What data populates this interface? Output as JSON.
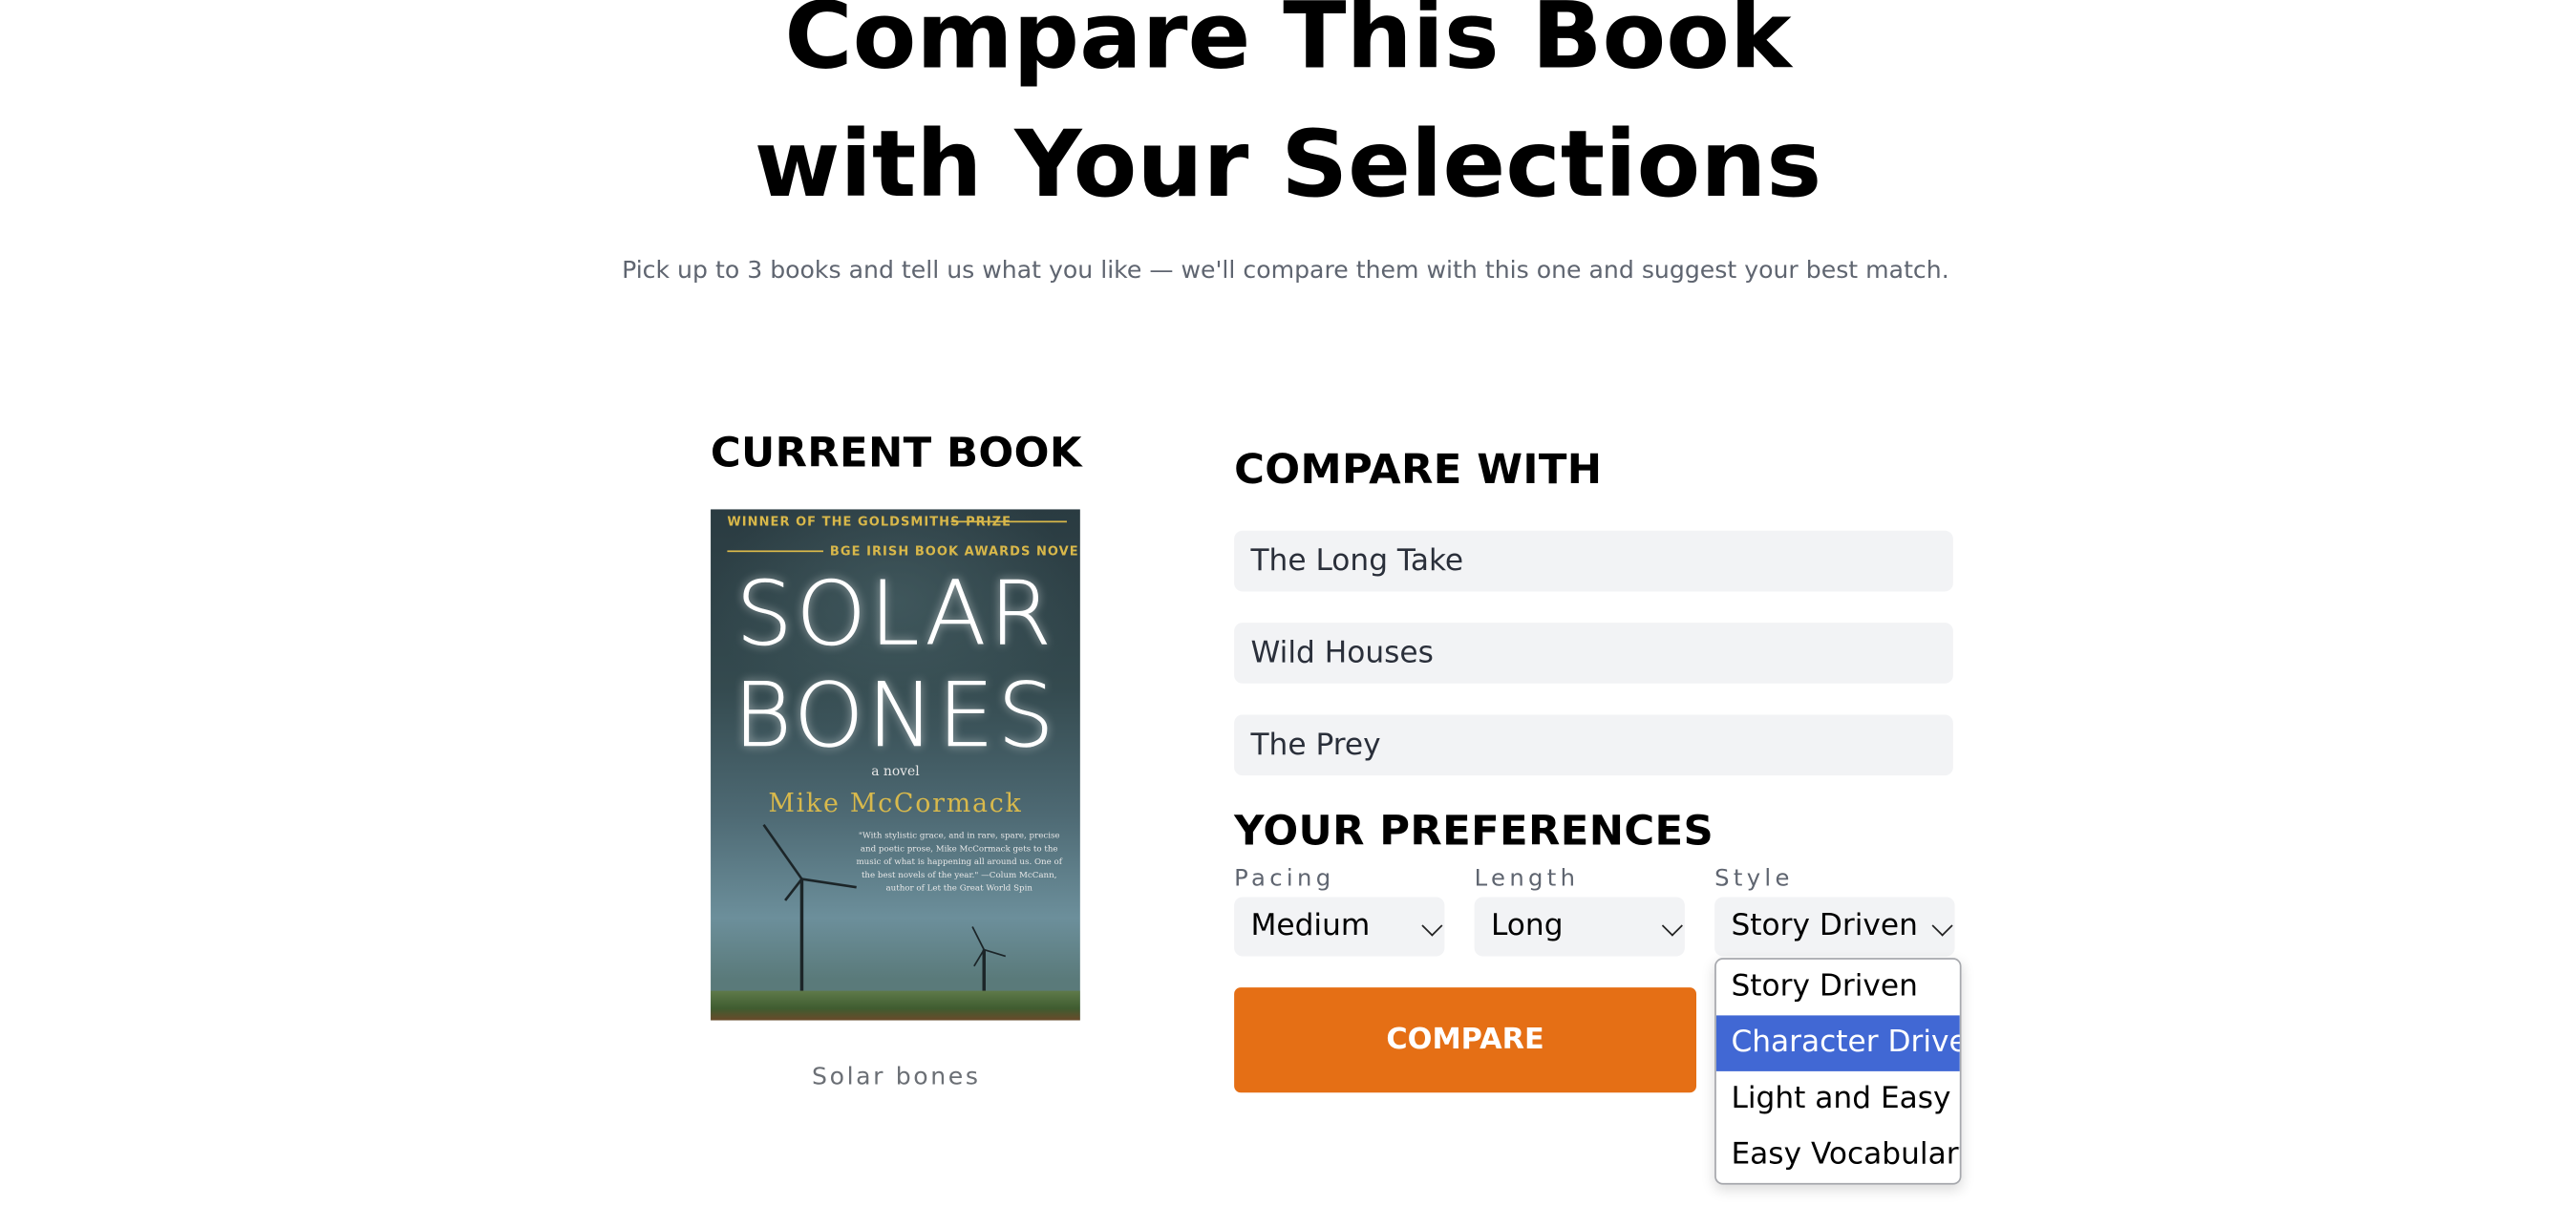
{
  "page": {
    "title_line1": "Compare This Book",
    "title_line2": "with Your Selections",
    "subtitle": "Pick up to 3 books and tell us what you like — we'll compare them with this one and suggest your best match."
  },
  "current_book": {
    "heading": "CURRENT BOOK",
    "caption": "Solar bones",
    "cover": {
      "tag_line1": "WINNER OF THE GOLDSMITHS PRIZE",
      "tag_line2": "BGE IRISH BOOK AWARDS NOVEL OF THE YEAR",
      "title_word1": "SOLAR",
      "title_word2": "BONES",
      "subtitle": "a novel",
      "author": "Mike McCormack",
      "quote": "\"With stylistic grace, and in rare, spare, precise and poetic prose, Mike McCormack gets to the music of what is happening all around us. One of the best novels of the year.\" —Colum McCann, author of Let the Great World Spin"
    }
  },
  "compare": {
    "heading": "COMPARE WITH",
    "books": [
      "The Long Take",
      "Wild Houses",
      "The Prey"
    ]
  },
  "preferences": {
    "heading": "YOUR PREFERENCES",
    "pacing": {
      "label": "Pacing",
      "value": "Medium"
    },
    "length": {
      "label": "Length",
      "value": "Long"
    },
    "style": {
      "label": "Style",
      "value": "Story Driven",
      "options": [
        "Story Driven",
        "Character Driven",
        "Light and Easy",
        "Easy Vocabulary"
      ],
      "highlighted": "Character Driven"
    }
  },
  "actions": {
    "compare_label": "COMPARE"
  },
  "colors": {
    "accent": "#e56f15",
    "highlight": "#4168d4",
    "field_bg": "#f2f3f5"
  }
}
